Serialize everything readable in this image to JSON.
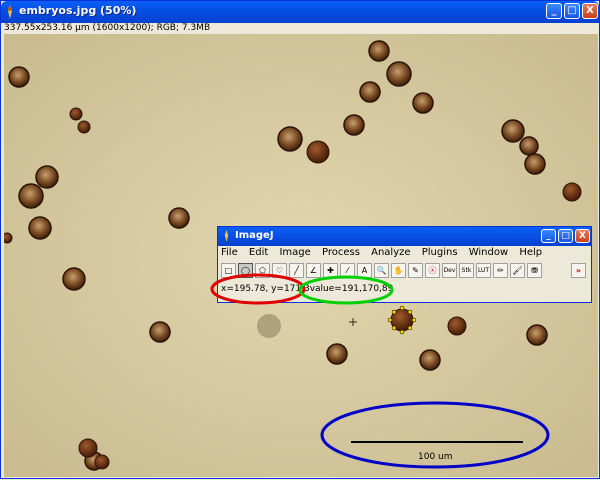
{
  "window": {
    "title": "embryos.jpg (50%)",
    "info": "337.55x253.16 µm (1600x1200); RGB; 7.3MB",
    "min_label": "_",
    "max_label": "□",
    "close_label": "X"
  },
  "imagej": {
    "title": "ImageJ",
    "menu": [
      "File",
      "Edit",
      "Image",
      "Process",
      "Analyze",
      "Plugins",
      "Window",
      "Help"
    ],
    "tools": [
      {
        "name": "rectangle-tool",
        "glyph": "□"
      },
      {
        "name": "oval-tool",
        "glyph": "◯"
      },
      {
        "name": "polygon-tool",
        "glyph": "⬠"
      },
      {
        "name": "freehand-tool",
        "glyph": "♡"
      },
      {
        "name": "line-tool",
        "glyph": "╱"
      },
      {
        "name": "angle-tool",
        "glyph": "∠"
      },
      {
        "name": "point-tool",
        "glyph": "✚"
      },
      {
        "name": "wand-tool",
        "glyph": "⁄"
      },
      {
        "name": "text-tool",
        "glyph": "A"
      },
      {
        "name": "magnifier-tool",
        "glyph": "🔍"
      },
      {
        "name": "hand-tool",
        "glyph": "✋"
      },
      {
        "name": "dropper-tool",
        "glyph": "✎"
      },
      {
        "name": "macro-tool",
        "glyph": "ⓧ"
      },
      {
        "name": "dev-tool",
        "glyph": "Dev"
      },
      {
        "name": "stk-tool",
        "glyph": "Stk"
      },
      {
        "name": "lut-tool",
        "glyph": "LUT"
      },
      {
        "name": "pencil-tool",
        "glyph": "✏"
      },
      {
        "name": "brush-tool",
        "glyph": "🖌"
      },
      {
        "name": "flood-tool",
        "glyph": "⛃"
      },
      {
        "name": "more-tools",
        "glyph": "»"
      }
    ],
    "status_coords": "x=195.78, y=171.3",
    "status_value": "value=191,170,89",
    "min_label": "_",
    "max_label": "□",
    "close_label": "X"
  },
  "scale_bar": {
    "label": "100 um"
  },
  "annotation_colors": {
    "coords": "#e00000",
    "value": "#00d000",
    "scale": "#0000c8"
  }
}
